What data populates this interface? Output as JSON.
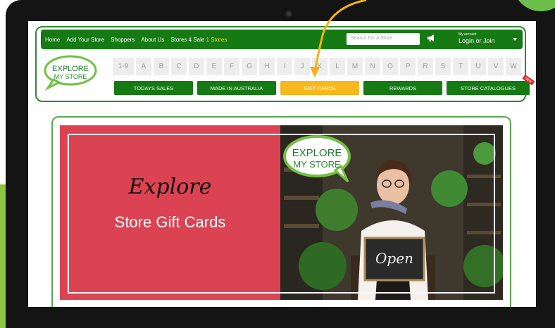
{
  "topnav": {
    "links": [
      "Home",
      "Add Your Store",
      "Shoppers",
      "About Us",
      "Stores 4 Sale"
    ],
    "stores_count": "1 Stores",
    "search_placeholder": "Search For A Store",
    "account_small": "My account",
    "account_big": "Login or Join"
  },
  "logo": {
    "line1": "EXPLORE",
    "line2": "MY STORE"
  },
  "alphabet": [
    "1-9",
    "A",
    "B",
    "C",
    "D",
    "E",
    "F",
    "G",
    "H",
    "I",
    "J",
    "K",
    "L",
    "M",
    "N",
    "O",
    "P",
    "R",
    "S",
    "T",
    "U",
    "V",
    "W"
  ],
  "categories": [
    {
      "label": "TODAYS SALES",
      "active": false
    },
    {
      "label": "MADE IN AUSTRALIA",
      "active": false
    },
    {
      "label": "GIFT CARDS",
      "active": true
    },
    {
      "label": "REWARDS",
      "active": false
    },
    {
      "label": "STORE CATALOGUES",
      "active": false,
      "badge": "NEW"
    }
  ],
  "banner": {
    "script_text": "Explore",
    "title": "Store Gift Cards",
    "logo_line1": "EXPLORE",
    "logo_line2": "MY STORE",
    "sign_text": "Open"
  },
  "colors": {
    "brand_green": "#157a14",
    "accent_yellow": "#f7b81e",
    "banner_red": "#db4353"
  }
}
